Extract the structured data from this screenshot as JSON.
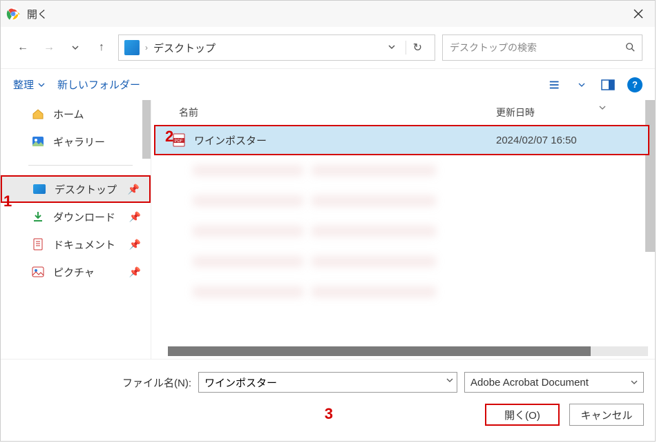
{
  "title": "開く",
  "breadcrumb": {
    "location": "デスクトップ"
  },
  "search": {
    "placeholder": "デスクトップの検索"
  },
  "toolbar": {
    "organize": "整理",
    "newfolder": "新しいフォルダー"
  },
  "sidebar": {
    "home": "ホーム",
    "gallery": "ギャラリー",
    "desktop": "デスクトップ",
    "downloads": "ダウンロード",
    "documents": "ドキュメント",
    "pictures": "ピクチャ"
  },
  "columns": {
    "name": "名前",
    "date": "更新日時"
  },
  "files": {
    "selected": {
      "name": "ワインポスター",
      "date": "2024/02/07 16:50"
    }
  },
  "footer": {
    "filename_label": "ファイル名(N):",
    "filename_value": "ワインポスター",
    "filter": "Adobe Acrobat Document",
    "open": "開く(O)",
    "cancel": "キャンセル"
  },
  "annotations": {
    "a1": "1",
    "a2": "2",
    "a3": "3"
  }
}
